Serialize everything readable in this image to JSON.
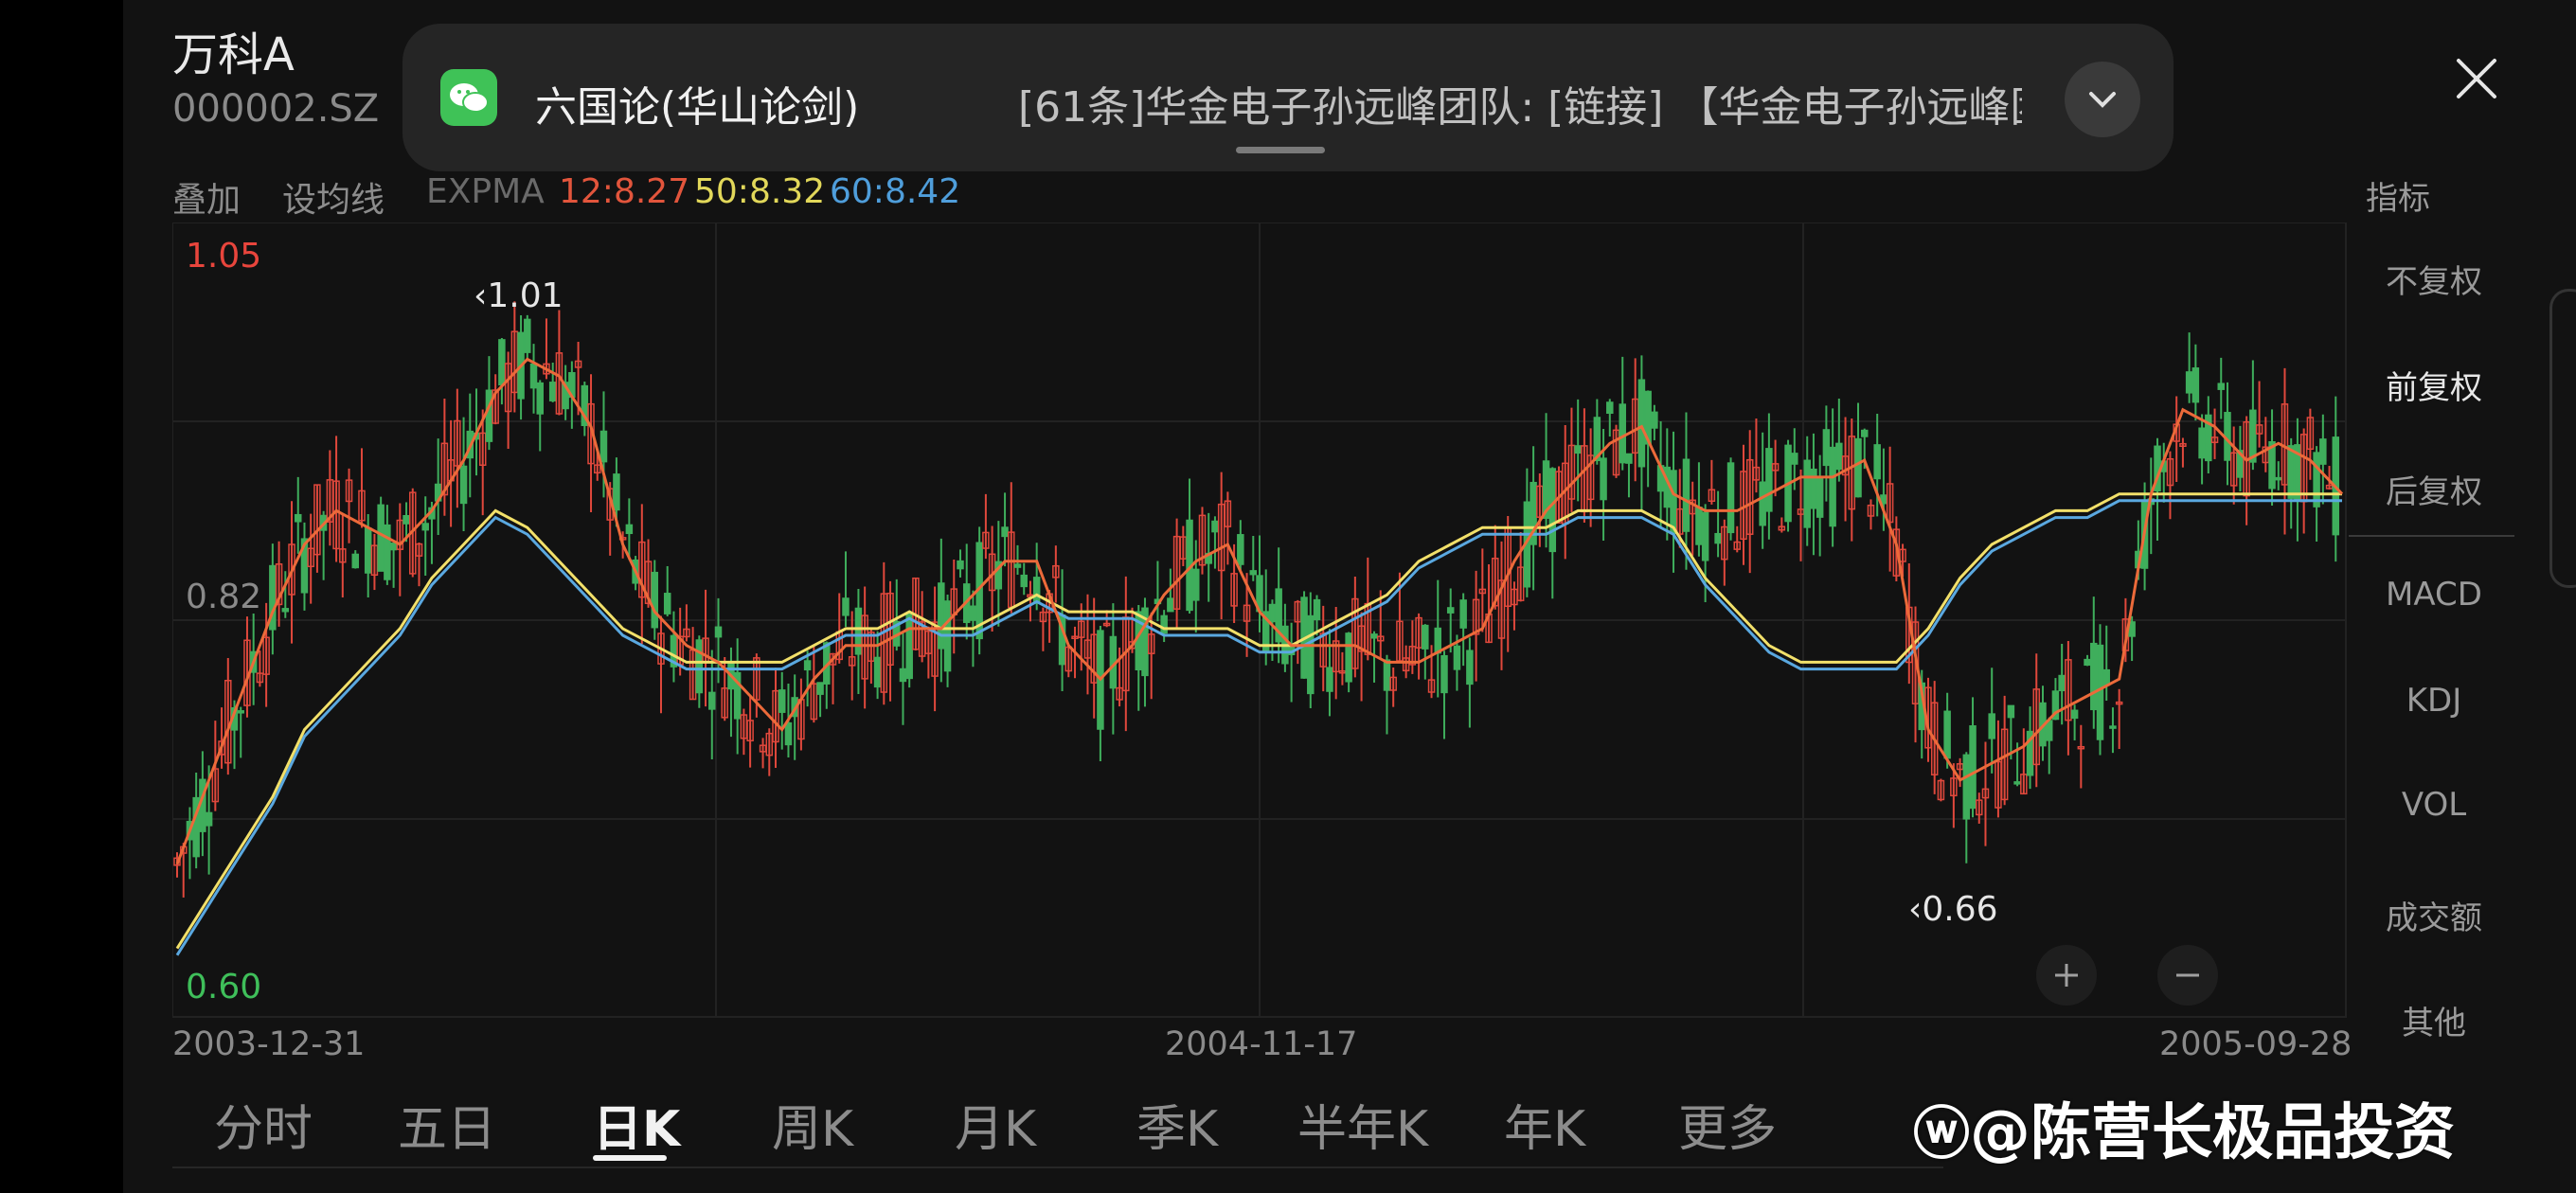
{
  "stock": {
    "name": "万科A",
    "code": "000002.SZ"
  },
  "notification": {
    "app_icon": "wechat-icon",
    "sender": "六国论(华山论剑)",
    "message": "[61条]华金电子孙远峰团队: [链接] 【华金电子孙远峰团…"
  },
  "toolbar": {
    "overlay": "叠加",
    "set_ma": "设均线",
    "expma_label": "EXPMA",
    "expma12": "12:8.27",
    "expma50": "50:8.32",
    "expma60": "60:8.42",
    "indicators": "指标"
  },
  "right_panel": [
    "不复权",
    "前复权",
    "后复权",
    "MACD",
    "KDJ",
    "VOL",
    "成交额",
    "其他"
  ],
  "chart_data": {
    "type": "candlestick",
    "y_labels": {
      "top": "1.05",
      "mid": "0.82",
      "bottom": "0.60"
    },
    "high_marker": "1.01",
    "low_marker": "0.66",
    "x_labels": [
      "2003-12-31",
      "2004-11-17",
      "2005-09-28"
    ],
    "ylim": [
      0.6,
      1.05
    ],
    "colors": {
      "up": "#e0483c",
      "down": "#3fae5c",
      "ema12": "#ec6a3a",
      "ema50": "#f2e06a",
      "ema60": "#5aa8e0",
      "top_label": "#e8453c",
      "bottom_label": "#3fbf5a"
    },
    "ema12": [
      0.68,
      0.73,
      0.78,
      0.83,
      0.87,
      0.89,
      0.88,
      0.87,
      0.89,
      0.92,
      0.96,
      0.98,
      0.97,
      0.94,
      0.87,
      0.83,
      0.81,
      0.8,
      0.78,
      0.76,
      0.79,
      0.81,
      0.81,
      0.82,
      0.82,
      0.84,
      0.86,
      0.86,
      0.81,
      0.79,
      0.81,
      0.84,
      0.86,
      0.87,
      0.83,
      0.81,
      0.81,
      0.81,
      0.8,
      0.8,
      0.81,
      0.82,
      0.86,
      0.89,
      0.91,
      0.93,
      0.94,
      0.9,
      0.89,
      0.89,
      0.9,
      0.91,
      0.91,
      0.92,
      0.87,
      0.76,
      0.73,
      0.74,
      0.75,
      0.77,
      0.78,
      0.79,
      0.9,
      0.95,
      0.94,
      0.92,
      0.93,
      0.92,
      0.9
    ],
    "ema50": [
      0.63,
      0.66,
      0.69,
      0.72,
      0.76,
      0.78,
      0.8,
      0.82,
      0.85,
      0.87,
      0.89,
      0.88,
      0.86,
      0.84,
      0.82,
      0.81,
      0.8,
      0.8,
      0.8,
      0.8,
      0.81,
      0.82,
      0.82,
      0.83,
      0.82,
      0.82,
      0.83,
      0.84,
      0.83,
      0.83,
      0.83,
      0.82,
      0.82,
      0.82,
      0.81,
      0.81,
      0.82,
      0.83,
      0.84,
      0.86,
      0.87,
      0.88,
      0.88,
      0.88,
      0.89,
      0.89,
      0.89,
      0.88,
      0.85,
      0.83,
      0.81,
      0.8,
      0.8,
      0.8,
      0.8,
      0.82,
      0.85,
      0.87,
      0.88,
      0.89,
      0.89,
      0.9,
      0.9,
      0.9,
      0.9,
      0.9,
      0.9,
      0.9,
      0.9
    ]
  },
  "chart_controls": {
    "zoom_in": "plus-icon",
    "zoom_out": "minus-icon"
  },
  "tabs": [
    "分时",
    "五日",
    "日K",
    "周K",
    "月K",
    "季K",
    "半年K",
    "年K",
    "更多"
  ],
  "active_tab": "日K",
  "watermark": "@陈营长极品投资"
}
